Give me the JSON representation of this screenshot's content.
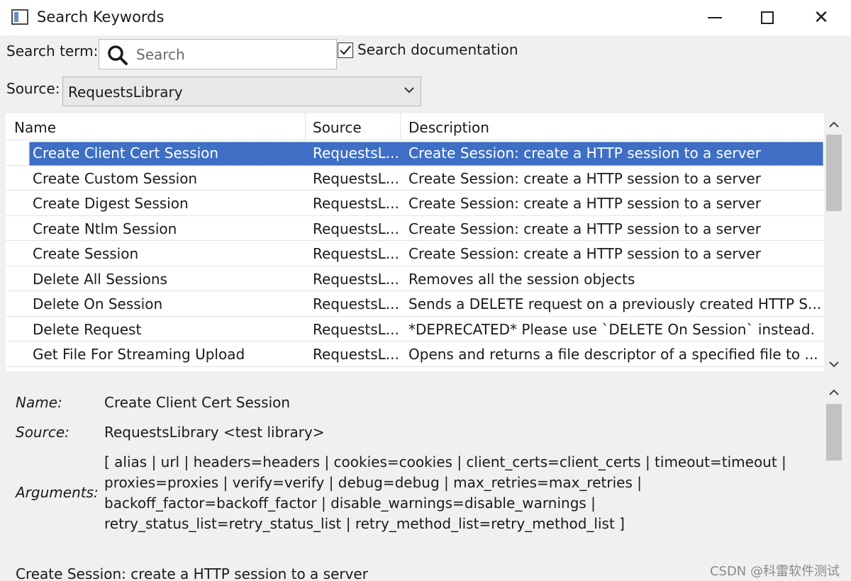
{
  "window": {
    "title": "Search Keywords",
    "icon": "app-window-icon"
  },
  "search": {
    "label": "Search term:",
    "placeholder": "Search",
    "value": "",
    "documentation_label": "Search documentation",
    "documentation_checked": true
  },
  "source_filter": {
    "label": "Source:",
    "selected": "RequestsLibrary"
  },
  "table": {
    "columns": [
      "Name",
      "Source",
      "Description"
    ],
    "rows": [
      {
        "name": "Create Client Cert Session",
        "source": "RequestsL...",
        "description": "Create Session: create a HTTP session to a server",
        "selected": true
      },
      {
        "name": "Create Custom Session",
        "source": "RequestsL...",
        "description": "Create Session: create a HTTP session to a server"
      },
      {
        "name": "Create Digest Session",
        "source": "RequestsL...",
        "description": "Create Session: create a HTTP session to a server"
      },
      {
        "name": "Create Ntlm Session",
        "source": "RequestsL...",
        "description": "Create Session: create a HTTP session to a server"
      },
      {
        "name": "Create Session",
        "source": "RequestsL...",
        "description": "Create Session: create a HTTP session to a server"
      },
      {
        "name": "Delete All Sessions",
        "source": "RequestsL...",
        "description": "Removes all the session objects"
      },
      {
        "name": "Delete On Session",
        "source": "RequestsL...",
        "description": "Sends a DELETE request on a previously created HTTP S..."
      },
      {
        "name": "Delete Request",
        "source": "RequestsL...",
        "description": "*DEPRECATED* Please use `DELETE On Session` instead."
      },
      {
        "name": "Get File For Streaming Upload",
        "source": "RequestsL...",
        "description": "Opens and returns a file descriptor of a specified file to ..."
      }
    ]
  },
  "details": {
    "name_label": "Name:",
    "name_value": "Create Client Cert Session",
    "source_label": "Source:",
    "source_value": "RequestsLibrary <test library>",
    "arguments_label": "Arguments:",
    "arguments_lines": [
      "[ alias | url | headers=headers | cookies=cookies | client_certs=client_certs | timeout=timeout |",
      "proxies=proxies | verify=verify | debug=debug | max_retries=max_retries |",
      "backoff_factor=backoff_factor | disable_warnings=disable_warnings |",
      "retry_status_list=retry_status_list | retry_method_list=retry_method_list ]"
    ],
    "description": "Create Session: create a HTTP session to a server"
  },
  "watermark": "CSDN @科雷软件测试"
}
